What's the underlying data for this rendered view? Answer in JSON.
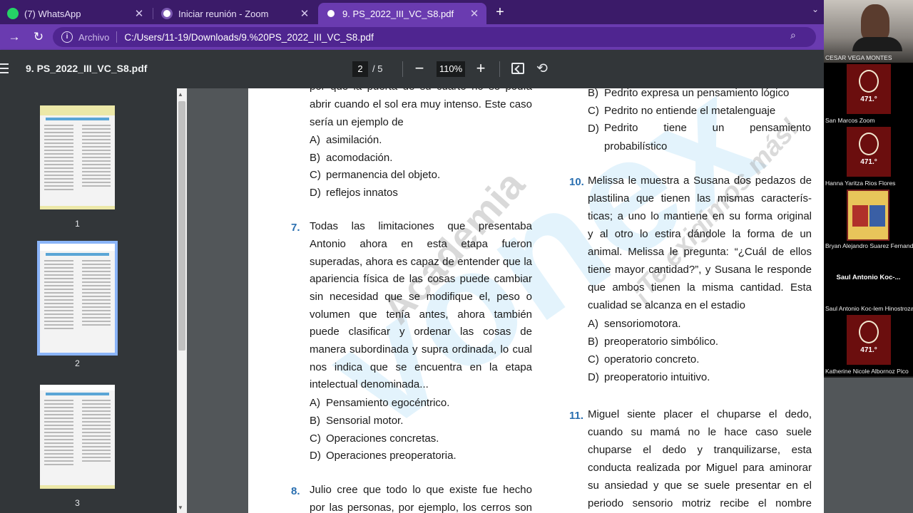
{
  "browser": {
    "tabs": [
      {
        "title": "(7) WhatsApp",
        "icon": "whatsapp-icon",
        "color": "#25d366"
      },
      {
        "title": "Iniciar reunión - Zoom",
        "icon": "zoom-icon",
        "color": "#2d8cff"
      },
      {
        "title": "9. PS_2022_III_VC_S8.pdf",
        "icon": "globe-icon",
        "color": "#ffffff",
        "active": true
      }
    ],
    "scheme": "Archivo",
    "url": "C:/Users/11-19/Downloads/9.%20PS_2022_III_VC_S8.pdf"
  },
  "pdf_viewer": {
    "title": "9. PS_2022_III_VC_S8.pdf",
    "current_page": "2",
    "total_pages": "/  5",
    "zoom": "110%",
    "thumbnails": [
      {
        "label": "1"
      },
      {
        "label": "2",
        "selected": true
      },
      {
        "label": "3"
      }
    ]
  },
  "document": {
    "watermark_academy": "Academia",
    "watermark_slogan": "¡Te exigimos más!",
    "watermark_logo": "vonex",
    "left_column": {
      "q6_tail": [
        "por qué la puerta de su cuarto no se podía",
        "abrir cuando el sol era muy intenso. Este caso",
        "sería un ejemplo de"
      ],
      "q6_options": [
        {
          "letter": "A)",
          "text": "asimilación."
        },
        {
          "letter": "B)",
          "text": "acomodación."
        },
        {
          "letter": "C)",
          "text": "permanencia del objeto."
        },
        {
          "letter": "D)",
          "text": "reflejos innatos"
        }
      ],
      "q7_number": "7.",
      "q7_lines": [
        "Todas las limitaciones que presentaba",
        "Antonio ahora en esta etapa fueron",
        "superadas, ahora es capaz de entender que la",
        "apariencia física de las cosas puede cambiar",
        "sin necesidad que se modifique el, peso o",
        "volumen que tenía antes, ahora también",
        "puede clasificar y ordenar las cosas de",
        "manera subordinada y supra ordinada, lo cual",
        "nos indica que se encuentra en la etapa",
        "intelectual denominada..."
      ],
      "q7_options": [
        {
          "letter": "A)",
          "text": "Pensamiento egocéntrico."
        },
        {
          "letter": "B)",
          "text": "Sensorial motor."
        },
        {
          "letter": "C)",
          "text": "Operaciones concretas."
        },
        {
          "letter": "D)",
          "text": "Operaciones preoperatoria."
        }
      ],
      "q8_number": "8.",
      "q8_lines": [
        "Julio cree que todo lo que existe fue hecho",
        "por las personas, por ejemplo, los cerros son"
      ]
    },
    "right_column": {
      "q9_options": [
        {
          "letter": "B)",
          "text": "Pedrito expresa un pensamiento lógico"
        },
        {
          "letter": "C)",
          "text": "Pedrito no entiende el metalenguaje"
        },
        {
          "letter": "D)",
          "text": "Pedrito tiene un pensamiento"
        }
      ],
      "q9_option_d_cont": "probabilístico",
      "q10_number": "10.",
      "q10_lines": [
        "Melissa le muestra a Susana dos pedazos de",
        "plastilina que tienen las mismas caracterís-",
        "ticas; a uno lo mantiene en su forma original",
        "y al otro lo estira dándole la forma de un",
        "animal. Melissa le pregunta: “¿Cuál de ellos",
        "tiene mayor cantidad?”, y Susana le responde",
        "que ambos tienen la misma cantidad. Esta",
        "cualidad se alcanza en el estadio"
      ],
      "q10_options": [
        {
          "letter": "A)",
          "text": "sensoriomotora."
        },
        {
          "letter": "B)",
          "text": "preoperatorio simbólico."
        },
        {
          "letter": "C)",
          "text": "operatorio concreto."
        },
        {
          "letter": "D)",
          "text": "preoperatorio intuitivo."
        }
      ],
      "q11_number": "11.",
      "q11_lines": [
        "Miguel siente placer el chuparse el dedo,",
        "cuando su mamá no le hace caso suele",
        "chuparse el dedo y tranquilizarse, esta",
        "conducta realizada por Miguel para aminorar",
        "su ansiedad y que se suele presentar en el",
        "periodo sensorio motriz recibe el nombre"
      ]
    }
  },
  "zoom_participants": [
    {
      "name": "CESAR VEGA MONTES",
      "type": "video"
    },
    {
      "name": "San Marcos Zoom",
      "type": "crest",
      "badge": "471.°"
    },
    {
      "name": "Hanna Yaritza Rios Flores",
      "type": "crest",
      "badge": "471.°"
    },
    {
      "name": "Bryan Alejandro Suarez Fernandez",
      "type": "shield"
    },
    {
      "name": "Saul Antonio Koc-lem Hinostroza",
      "type": "text",
      "big_label": "Saul Antonio Koc-..."
    },
    {
      "name": "Katherine Nicole Albornoz Pico",
      "type": "crest",
      "badge": "471.°"
    }
  ]
}
